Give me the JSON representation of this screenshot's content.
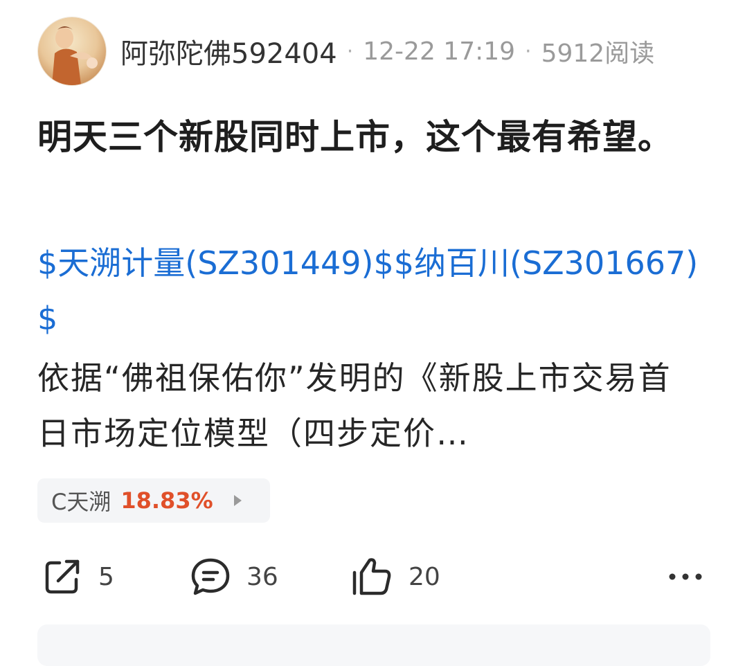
{
  "post": {
    "author": "阿弥陀佛592404",
    "time": "12-22 17:19",
    "reads": "5912阅读",
    "separator": "·",
    "title": "明天三个新股同时上市，这个最有希望。",
    "stock_links": [
      "$天溯计量(SZ301449)$",
      "$纳百川(SZ301667)$"
    ],
    "excerpt": "依据“佛祖保佑你”发明的《新股上市交易首日市场定位模型（四步定价…",
    "quote_chip": {
      "name": "C天溯",
      "change": "18.83%",
      "change_color": "#e0502a"
    },
    "actions": {
      "share_count": "5",
      "comment_count": "36",
      "like_count": "20"
    },
    "icons": {
      "share": "share-icon",
      "comment": "comment-icon",
      "like": "thumbs-up-icon",
      "more": "more-dots-icon",
      "chip_arrow": "play-arrow-icon"
    },
    "colors": {
      "link": "#1a6dd4",
      "meta": "#9a9a9a",
      "title": "#1e1e1e"
    }
  }
}
